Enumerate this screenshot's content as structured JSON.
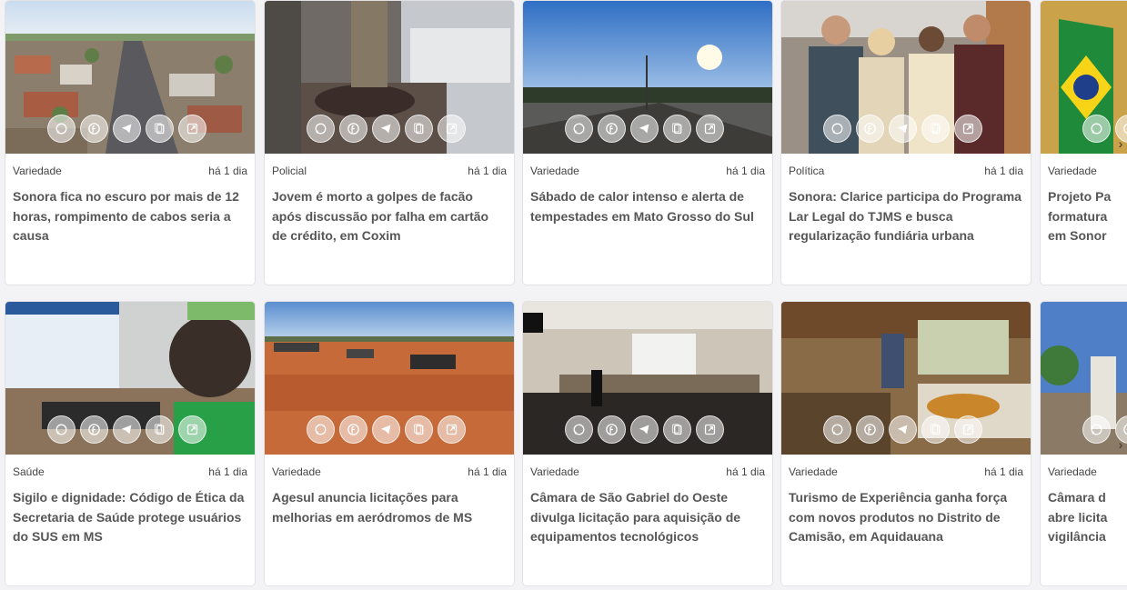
{
  "share_icons": [
    "whatsapp-icon",
    "facebook-icon",
    "telegram-icon",
    "copy-icon",
    "external-link-icon"
  ],
  "carousel_next": "›",
  "rows": [
    {
      "cards": [
        {
          "category": "Variedade",
          "time": "há 1 dia",
          "title": "Sonora fica no escuro por mais de 12 horas, rompimento de cabos seria a causa"
        },
        {
          "category": "Policial",
          "time": "há 1 dia",
          "title": "Jovem é morto a golpes de facão após discussão por falha em cartão de crédito, em Coxim"
        },
        {
          "category": "Variedade",
          "time": "há 1 dia",
          "title": "Sábado de calor intenso e alerta de tempestades em Mato Grosso do Sul"
        },
        {
          "category": "Política",
          "time": "há 1 dia",
          "title": "Sonora: Clarice participa do Programa Lar Legal do TJMS e busca regularização fundiária urbana"
        },
        {
          "category": "Variedade",
          "time": "",
          "title": "Projeto Pa formatura em Sonor"
        }
      ]
    },
    {
      "cards": [
        {
          "category": "Saúde",
          "time": "há 1 dia",
          "title": "Sigilo e dignidade: Código de Ética da Secretaria de Saúde protege usuários do SUS em MS"
        },
        {
          "category": "Variedade",
          "time": "há 1 dia",
          "title": "Agesul anuncia licitações para melhorias em aeródromos de MS"
        },
        {
          "category": "Variedade",
          "time": "há 1 dia",
          "title": "Câmara de São Gabriel do Oeste divulga licitação para aquisição de equipamentos tecnológicos"
        },
        {
          "category": "Variedade",
          "time": "há 1 dia",
          "title": "Turismo de Experiência ganha força com novos produtos no Distrito de Camisão, em Aquidauana"
        },
        {
          "category": "Variedade",
          "time": "",
          "title": "Câmara d abre licita vigilância"
        }
      ]
    }
  ]
}
